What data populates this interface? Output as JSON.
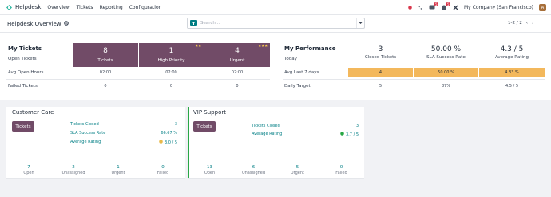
{
  "navbar": {
    "app_name": "Helpdesk",
    "menu": [
      "Overview",
      "Tickets",
      "Reporting",
      "Configuration"
    ],
    "activity_badge": "5",
    "messages_badge": "5",
    "company": "My Company (San Francisco)",
    "avatar_letter": "A"
  },
  "control_panel": {
    "title": "Helpdesk Overview",
    "search_placeholder": "Search...",
    "pager": "1-2 / 2"
  },
  "my_tickets": {
    "title": "My Tickets",
    "header_label": "Open Tickets",
    "rows": [
      "Avg Open Hours",
      "Failed Tickets"
    ],
    "tiles": [
      {
        "value": "8",
        "label": "Tickets",
        "stars": "",
        "avg_hours": "02:00",
        "failed": "0"
      },
      {
        "value": "1",
        "label": "High Priority",
        "stars": "★★",
        "avg_hours": "02:00",
        "failed": "0"
      },
      {
        "value": "4",
        "label": "Urgent",
        "stars": "★★★",
        "avg_hours": "02:00",
        "failed": "0"
      }
    ]
  },
  "my_performance": {
    "title": "My Performance",
    "today_label": "Today",
    "rows": [
      "Avg Last 7 days",
      "Daily Target"
    ],
    "columns": [
      {
        "value": "3",
        "label": "Closed Tickets",
        "avg7": "4",
        "target": "5"
      },
      {
        "value": "50.00 %",
        "label": "SLA Success Rate",
        "avg7": "50.00 %",
        "target": "87%"
      },
      {
        "value": "4.3 / 5",
        "label": "Average Rating",
        "avg7": "4.33 %",
        "target": "4.5 / 5"
      }
    ]
  },
  "teams": [
    {
      "name": "Customer Care",
      "button": "Tickets",
      "stats": [
        {
          "label": "Tickets Closed",
          "value": "3"
        },
        {
          "label": "SLA Success Rate",
          "value": "66.67 %"
        },
        {
          "label": "Average Rating",
          "value": "3.0 / 5"
        }
      ],
      "footer": [
        {
          "num": "7",
          "label": "Open"
        },
        {
          "num": "2",
          "label": "Unassigned"
        },
        {
          "num": "1",
          "label": "Urgent"
        },
        {
          "num": "0",
          "label": "Failed"
        }
      ]
    },
    {
      "name": "VIP Support",
      "button": "Tickets",
      "stats": [
        {
          "label": "Tickets Closed",
          "value": "3"
        },
        {
          "label": "Average Rating",
          "value": "3.7 / 5"
        }
      ],
      "footer": [
        {
          "num": "13",
          "label": "Open"
        },
        {
          "num": "6",
          "label": "Unassigned"
        },
        {
          "num": "5",
          "label": "Urgent"
        },
        {
          "num": "0",
          "label": "Failed"
        }
      ]
    }
  ],
  "colors": {
    "primary": "#714b67",
    "accent": "#017e84",
    "highlight": "#f3b85c",
    "team_bar": "#28a745"
  }
}
